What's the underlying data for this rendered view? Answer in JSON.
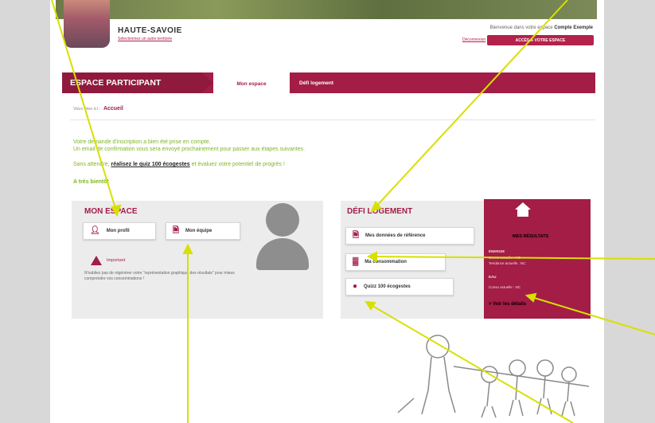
{
  "header": {
    "region": "HAUTE-SAVOIE",
    "region_link": "Sélectionnez un autre territoire",
    "welcome_text": "Bienvenue dans votre espace",
    "welcome_name": "Compte Exemple",
    "disconnect": "Déconnexion",
    "access_button": "ACCÈS À VOTRE ESPACE"
  },
  "nav": {
    "title": "ESPACE PARTICIPANT",
    "tabs": [
      {
        "label": "Mon espace",
        "active": true
      },
      {
        "label": "Défi logement",
        "active": false
      }
    ]
  },
  "breadcrumb": {
    "prefix": "Vous êtes ici :",
    "current": "Accueil"
  },
  "messages": {
    "line1": "Votre demande d'inscription a bien été prise en compte.",
    "line2": "Un email de confirmation vous sera envoyé prochainement pour passer aux étapes suivantes.",
    "line3_pre": "Sans attendre,",
    "line3_link": "réalisez le quiz 100 écogestes",
    "line3_post": "et évaluez votre potentiel de progrès !",
    "line4": "A très bientôt"
  },
  "mon_espace": {
    "title": "MON ESPACE",
    "profile_button": "Mon profil",
    "team_button": "Mon équipe",
    "important_label": "Important",
    "important_text": "N'oubliez pas de régénérer votre \"représentation graphique des résultats\" pour mieux comprendre vos consommations !"
  },
  "defi": {
    "title": "DÉFI LOGEMENT",
    "btn_reference": "Mes données de référence",
    "btn_consumption": "Ma consommation",
    "btn_quiz": "Quizz 100 écogestes"
  },
  "results": {
    "title": "MES RÉSULTATS",
    "energy_label": "ÉNERGIE",
    "energy_current": "Conso actuelle : NC",
    "energy_trend": "Tendance actuelle : NC",
    "water_label": "EAU",
    "water_current": "Conso actuelle : NC",
    "details_link": "> Voir les détails"
  },
  "colors": {
    "accent": "#a31d46",
    "green": "#7fb51f",
    "arrow": "#d7e000"
  }
}
